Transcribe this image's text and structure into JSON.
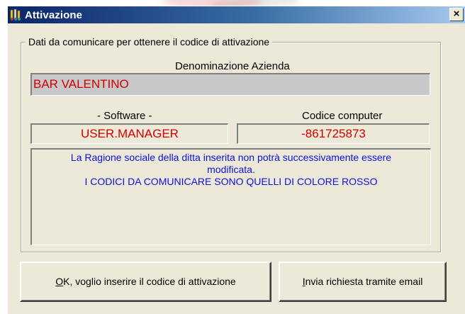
{
  "window": {
    "title": "Attivazione",
    "close_glyph": "×"
  },
  "group": {
    "legend": "Dati da comunicare per ottenere il codice di attivazione"
  },
  "azienda": {
    "label": "Denominazione Azienda",
    "value": "BAR VALENTINO"
  },
  "software": {
    "label": "- Software -",
    "value": "USER.MANAGER"
  },
  "codice": {
    "label": "Codice computer",
    "value": "-861725873"
  },
  "memo": {
    "lines": [
      "La Ragione sociale della ditta inserita non potrà successivamente essere",
      "modificata.",
      "I CODICI DA COMUNICARE SONO QUELLI DI COLORE ROSSO"
    ]
  },
  "buttons": {
    "ok_accel": "O",
    "ok_rest": "K, voglio inserire il codice di attivazione",
    "email_accel": "I",
    "email_rest": "nvia richiesta tramite email"
  },
  "colors": {
    "title_bar": "#0a246a",
    "dialog_bg": "#ece9d8",
    "code_text": "#d40000",
    "memo_text": "#1010e0"
  },
  "icons": {
    "title": "keys-icon",
    "close": "close-icon"
  }
}
